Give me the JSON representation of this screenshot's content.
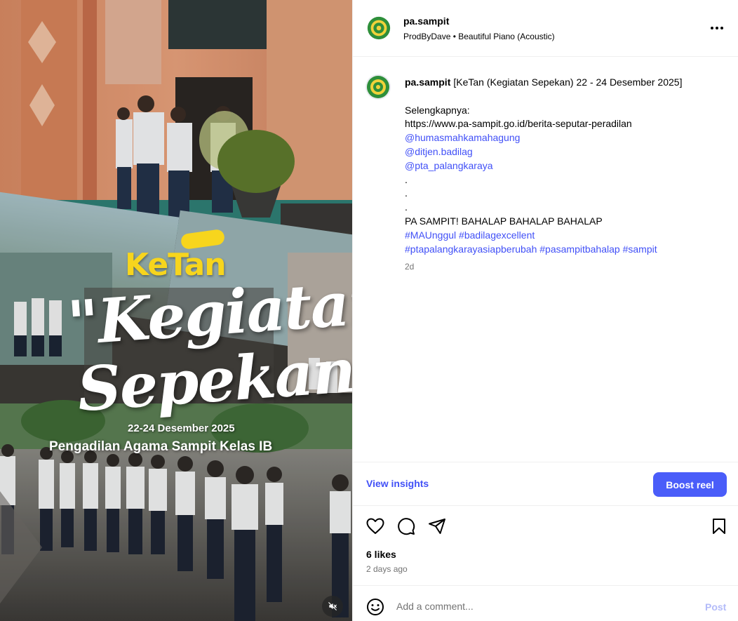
{
  "media": {
    "overlay_brand": "KeTan",
    "overlay_title_line1": "\"Kegiatan",
    "overlay_title_line2": "Sepekan\"",
    "overlay_date": "22-24 Desember 2025",
    "overlay_court": "Pengadilan Agama Sampit Kelas IB",
    "mute_icon": "speaker-muted-icon"
  },
  "header": {
    "username": "pa.sampit",
    "audio_artist": "ProdByDave",
    "audio_separator": " • ",
    "audio_track": "Beautiful Piano (Acoustic)",
    "more_icon": "more-options-icon"
  },
  "caption": {
    "username": "pa.sampit",
    "title": "[KeTan (Kegiatan Sepekan) 22 - 24 Desember 2025]",
    "more_label": "Selengkapnya:",
    "url": "https://www.pa-sampit.go.id/berita-seputar-peradilan",
    "mentions": [
      "@humasmahkamahagung",
      "@ditjen.badilag",
      "@pta_palangkaraya"
    ],
    "dots": [
      ".",
      ".",
      "."
    ],
    "tagline": "PA SAMPIT! BAHALAP BAHALAP BAHALAP",
    "hashtags_line1": [
      "#MAUnggul",
      "#badilagexcellent"
    ],
    "hashtags_line2": [
      "#ptapalangkarayasiapberubah",
      "#pasampitbahalap",
      "#sampit"
    ],
    "time_ago": "2d"
  },
  "insights": {
    "view_insights_label": "View insights",
    "boost_label": "Boost reel"
  },
  "actions": {
    "like_icon": "heart-icon",
    "comment_icon": "comment-icon",
    "share_icon": "share-icon",
    "save_icon": "bookmark-icon"
  },
  "stats": {
    "likes": "6 likes",
    "posted_ago": "2 days ago"
  },
  "comment": {
    "emoji_icon": "emoji-icon",
    "placeholder": "Add a comment...",
    "post_label": "Post"
  },
  "colors": {
    "link": "#4150f7",
    "boost_bg": "#4a5df9",
    "post_disabled": "#b3bbf9",
    "secondary_text": "#737373",
    "ketan_yellow": "#f7d51d"
  }
}
